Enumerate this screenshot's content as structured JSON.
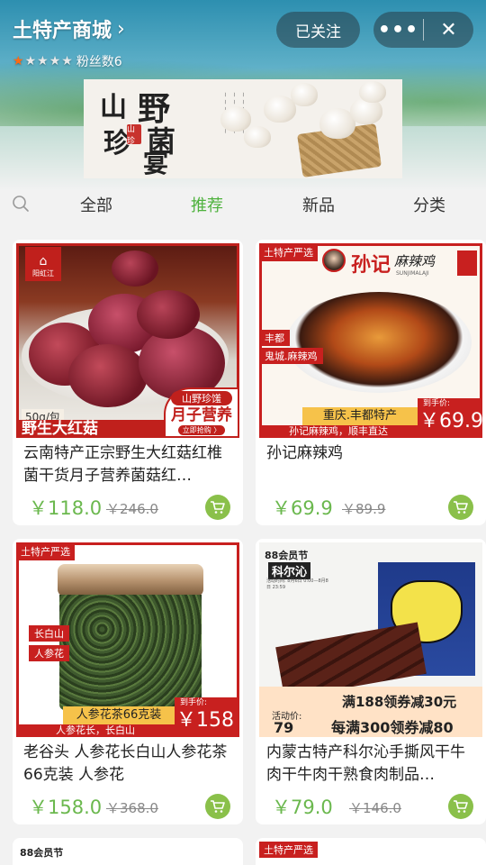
{
  "header": {
    "shop_name": "土特产商城",
    "rating_stars": 1,
    "rating_max": 5,
    "fans_label": "粉丝数6",
    "follow_label": "已关注"
  },
  "banner": {
    "logo_chars": [
      "山",
      "野",
      "珍",
      "菌",
      "宴"
    ],
    "logo_tag": "山珍"
  },
  "tabs": {
    "items": [
      "全部",
      "推荐",
      "新品",
      "分类"
    ],
    "active": "推荐"
  },
  "products": [
    {
      "title": "云南特产正宗野生大红菇红椎菌干货月子营养菌菇红…",
      "price": "￥118.0",
      "original_price": "￥246.0",
      "image": {
        "brand": "阳虹江",
        "weight": "50g/包",
        "name": "野生大红菇",
        "slogan_small": "山野珍馐",
        "slogan_big": "月子营养",
        "slogan_tip": "立即抢购 〉"
      }
    },
    {
      "title": "孙记麻辣鸡",
      "price": "￥69.9",
      "original_price": "￥89.9",
      "image": {
        "tag": "土特产严选",
        "brand": "孙记",
        "brand_script": "麻辣鸡",
        "brand_en": "SUNJIMALAJI",
        "side1": "丰都",
        "side2": "鬼城.麻辣鸡",
        "origin": "重庆.丰都特产",
        "slogan": "孙记麻辣鸡，顺丰直达",
        "hand_price_label": "到手价:",
        "hand_price": "￥69.9"
      }
    },
    {
      "title": "老谷头 人参花长白山人参花茶66克装 人参花",
      "price": "￥158.0",
      "original_price": "￥368.0",
      "image": {
        "tag": "土特产严选",
        "side1": "长白山",
        "side2": "人参花",
        "label": "人参花茶66克装",
        "slogan": "人参花长，长白山",
        "hand_price_label": "到手价:",
        "hand_price": "￥158"
      }
    },
    {
      "title": "内蒙古特产科尔沁手撕风干牛肉干牛肉干熟食肉制品…",
      "price": "￥79.0",
      "original_price": "￥146.0",
      "image": {
        "event": "88会员节",
        "brand": "科尔沁",
        "event_date": "活动时间: 8月6日 0:00—8月8日 23:59",
        "promo1": "满188领券减30元",
        "promo2": "每满300领券减80",
        "activity_price_label": "活动价:",
        "activity_price": "79"
      }
    }
  ],
  "partial_bottom": {
    "left_tag": "88会员节",
    "right_tag": "土特产严选"
  },
  "colors": {
    "accent_green": "#4fb23e",
    "price_green": "#6bb84e",
    "star_on": "#ff6a13",
    "brand_red": "#c8201f"
  }
}
